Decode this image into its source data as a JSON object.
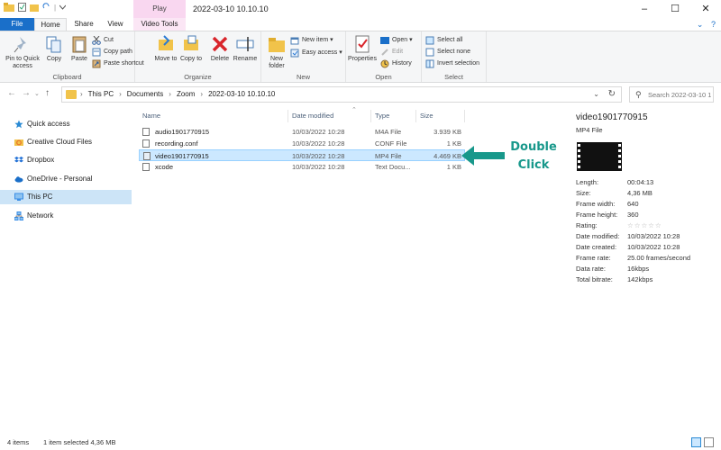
{
  "window": {
    "title": "2022-03-10 10.10.10",
    "contextual_tab": "Play",
    "controls": {
      "minimize": "–",
      "maximize": "☐",
      "close": "✕"
    }
  },
  "tabs": [
    {
      "label": "File",
      "active": false
    },
    {
      "label": "Home",
      "active": true
    },
    {
      "label": "Share",
      "active": false
    },
    {
      "label": "View",
      "active": false
    },
    {
      "label": "Video Tools",
      "active": false
    }
  ],
  "ribbon": {
    "clipboard": {
      "label": "Clipboard",
      "pin": "Pin to Quick access",
      "copy": "Copy",
      "paste": "Paste",
      "cut": "Cut",
      "copy_path": "Copy path",
      "paste_shortcut": "Paste shortcut"
    },
    "organize": {
      "label": "Organize",
      "move_to": "Move to",
      "copy_to": "Copy to",
      "delete": "Delete",
      "rename": "Rename"
    },
    "new": {
      "label": "New",
      "new_folder": "New folder",
      "new_item": "New item",
      "easy_access": "Easy access"
    },
    "open": {
      "label": "Open",
      "properties": "Properties",
      "open": "Open",
      "edit": "Edit",
      "history": "History"
    },
    "select": {
      "label": "Select",
      "select_all": "Select all",
      "select_none": "Select none",
      "invert": "Invert selection"
    }
  },
  "address": {
    "crumbs": [
      "This PC",
      "Documents",
      "Zoom",
      "2022-03-10 10.10.10"
    ],
    "search_placeholder": "Search 2022-03-10 1..."
  },
  "nav": {
    "items": [
      {
        "label": "Quick access",
        "icon": "star-icon",
        "color": "#2a8ad4"
      },
      {
        "label": "Creative Cloud Files",
        "icon": "creative-cloud-icon",
        "color": "#e8742b"
      },
      {
        "label": "Dropbox",
        "icon": "dropbox-icon",
        "color": "#1f6fd6"
      },
      {
        "label": "OneDrive - Personal",
        "icon": "onedrive-icon",
        "color": "#1a6fc9"
      },
      {
        "label": "This PC",
        "icon": "computer-icon",
        "color": "#3a8ee6",
        "selected": true
      },
      {
        "label": "Network",
        "icon": "network-icon",
        "color": "#3a8ee6"
      }
    ]
  },
  "columns": {
    "name": "Name",
    "date": "Date modified",
    "type": "Type",
    "size": "Size"
  },
  "files": [
    {
      "name": "audio1901770915",
      "date": "10/03/2022 10:28",
      "type": "M4A File",
      "size": "3.939 KB",
      "selected": false
    },
    {
      "name": "recording.conf",
      "date": "10/03/2022 10:28",
      "type": "CONF File",
      "size": "1 KB",
      "selected": false
    },
    {
      "name": "video1901770915",
      "date": "10/03/2022 10:28",
      "type": "MP4 File",
      "size": "4.469 KB",
      "selected": true
    },
    {
      "name": "xcode",
      "date": "10/03/2022 10:28",
      "type": "Text Docu...",
      "size": "1 KB",
      "selected": false
    }
  ],
  "annotation": {
    "line1": "Double",
    "line2": "Click",
    "color": "#18988b"
  },
  "details": {
    "title": "video1901770915",
    "type": "MP4 File",
    "props": [
      {
        "k": "Length:",
        "v": "00:04:13"
      },
      {
        "k": "Size:",
        "v": "4,36 MB"
      },
      {
        "k": "Frame width:",
        "v": "640"
      },
      {
        "k": "Frame height:",
        "v": "360"
      },
      {
        "k": "Rating:",
        "v": "☆☆☆☆☆"
      },
      {
        "k": "Date modified:",
        "v": "10/03/2022 10:28"
      },
      {
        "k": "Date created:",
        "v": "10/03/2022 10:28"
      },
      {
        "k": "Frame rate:",
        "v": "25.00 frames/second"
      },
      {
        "k": "Data rate:",
        "v": "16kbps"
      },
      {
        "k": "Total bitrate:",
        "v": "142kbps"
      }
    ]
  },
  "status": {
    "items": "4 items",
    "selected": "1 item selected  4,36 MB"
  }
}
